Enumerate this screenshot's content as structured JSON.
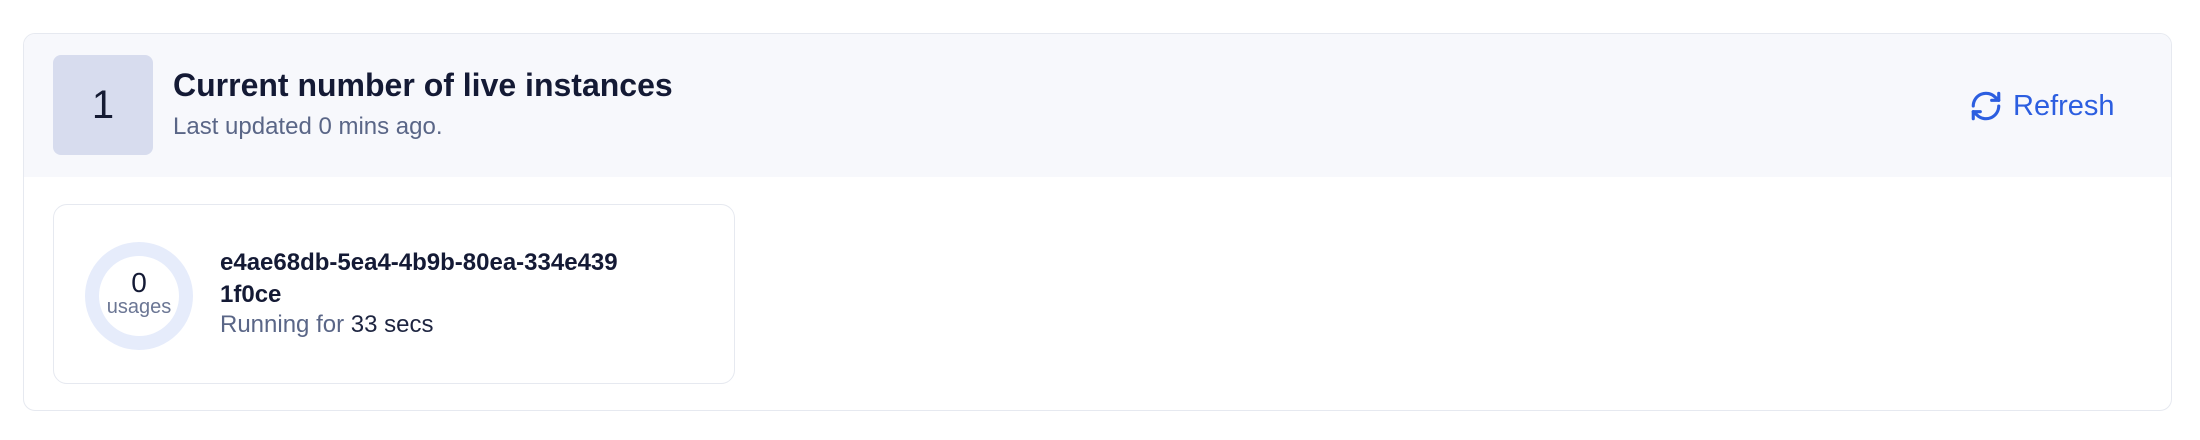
{
  "header": {
    "count": "1",
    "title": "Current number of live instances",
    "subtitle": "Last updated 0 mins ago.",
    "refresh_label": "Refresh",
    "refresh_icon": "refresh-icon"
  },
  "instances": [
    {
      "usage_count": "0",
      "usage_label": "usages",
      "id": "e4ae68db-5ea4-4b9b-80ea-334e4391f0ce",
      "running_prefix": "Running for",
      "running_duration": "33 secs"
    }
  ],
  "colors": {
    "accent": "#2c5ee0",
    "count_bg": "#d7dcee",
    "header_bg": "#f7f8fc",
    "ring": "#e6ecfb"
  }
}
